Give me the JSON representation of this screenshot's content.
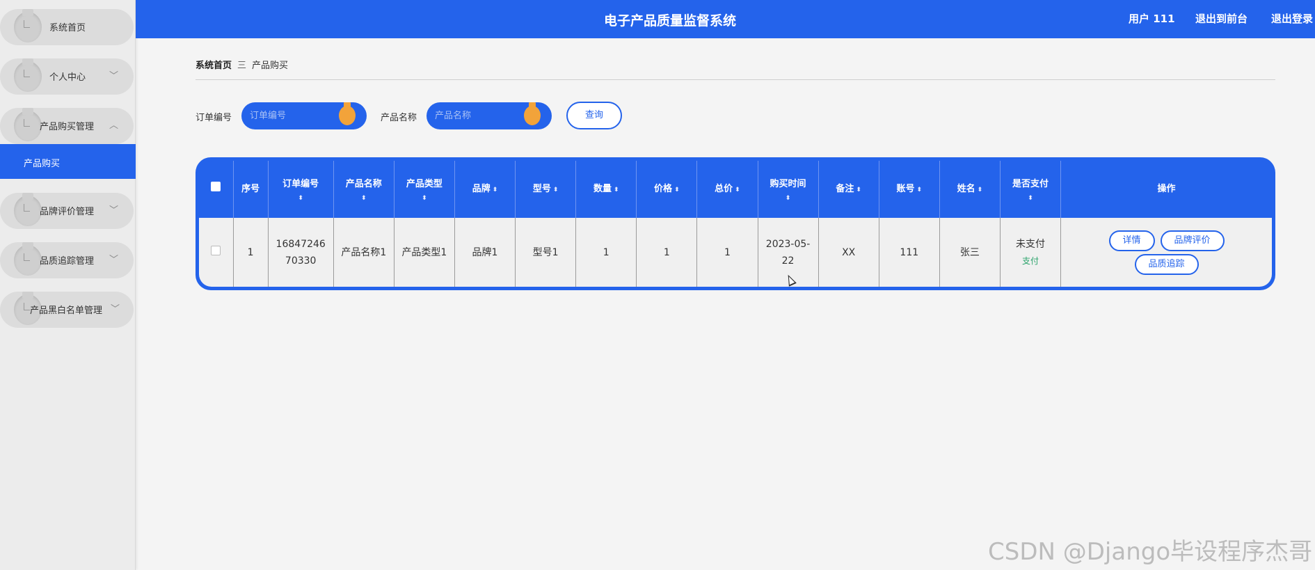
{
  "sidebar": {
    "items": [
      {
        "label": "系统首页",
        "has_chevron": false,
        "chevron": ""
      },
      {
        "label": "个人中心",
        "has_chevron": true,
        "chevron": "﹀"
      },
      {
        "label": "产品购买管理",
        "has_chevron": true,
        "chevron": "︿"
      },
      {
        "label": "品牌评价管理",
        "has_chevron": true,
        "chevron": "﹀"
      },
      {
        "label": "品质追踪管理",
        "has_chevron": true,
        "chevron": "﹀"
      },
      {
        "label": "产品黑白名单管理",
        "has_chevron": true,
        "chevron": "﹀"
      }
    ],
    "active_sub_item": "产品购买"
  },
  "header": {
    "title": "电子产品质量监督系统",
    "user": "用户 111",
    "front_link": "退出到前台",
    "logout": "退出登录"
  },
  "breadcrumb": {
    "home": "系统首页",
    "separator": "三",
    "current": "产品购买"
  },
  "search": {
    "order_no_label": "订单编号",
    "order_no_placeholder": "订单编号",
    "product_name_label": "产品名称",
    "product_name_placeholder": "产品名称",
    "query_button": "查询"
  },
  "table": {
    "columns": [
      "序号",
      "订单编号",
      "产品名称",
      "产品类型",
      "品牌",
      "型号",
      "数量",
      "价格",
      "总价",
      "购买时间",
      "备注",
      "账号",
      "姓名",
      "是否支付",
      "操作"
    ],
    "sort_glyph": "⬍",
    "rows": [
      {
        "index": "1",
        "order_no_line1": "16847246",
        "order_no_line2": "70330",
        "product_name": "产品名称1",
        "product_type": "产品类型1",
        "brand": "品牌1",
        "model": "型号1",
        "quantity": "1",
        "price": "1",
        "total": "1",
        "purchase_time_line1": "2023-05-",
        "purchase_time_line2": "22",
        "remark": "XX",
        "account": "111",
        "name": "张三",
        "paid_status": "未支付",
        "pay_link": "支付",
        "actions": [
          "详情",
          "品牌评价",
          "品质追踪"
        ]
      }
    ]
  },
  "watermark": "CSDN @Django毕设程序杰哥",
  "colors": {
    "primary": "#2463eb",
    "pay_link": "#2aa36b",
    "search_bulb": "#f2a33a"
  }
}
